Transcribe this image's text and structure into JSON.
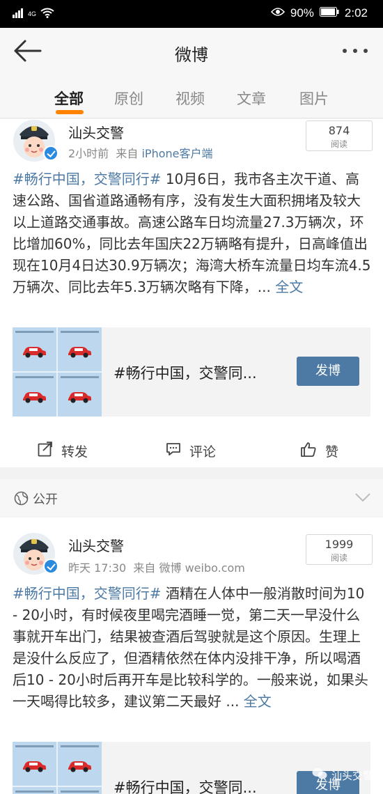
{
  "status_bar": {
    "network": "4G",
    "battery": "90%",
    "time": "2:02"
  },
  "app_bar": {
    "title": "微博"
  },
  "tabs": [
    {
      "label": "全部",
      "active": true
    },
    {
      "label": "原创",
      "active": false
    },
    {
      "label": "视频",
      "active": false
    },
    {
      "label": "文章",
      "active": false
    },
    {
      "label": "图片",
      "active": false
    }
  ],
  "posts": [
    {
      "username": "汕头交警",
      "time": "2小时前",
      "source_prefix": "来自",
      "source": "iPhone客户端",
      "reads_count": "874",
      "reads_label": "阅读",
      "hashtag": "#畅行中国，交警同行#",
      "body": " 10月6日，我市各主次干道、高速公路、国省道路通畅有序，没有发生大面积拥堵及较大以上道路交通事故。高速公路车日均流量27.3万辆次，环比增加60%，同比去年国庆22万辆略有提升，日高峰值出现在10月4日达30.9万辆次；海湾大桥车流量日均车流4.5万辆次、同比去年5.3万辆次略有下降，...",
      "more": " 全文",
      "share_text": "#畅行中国，交警同...",
      "share_button": "发博",
      "repost_label": "转发",
      "comment_label": "评论",
      "like_label": "赞"
    },
    {
      "username": "汕头交警",
      "time": "昨天 17:30",
      "source_prefix": "来自",
      "source": "微博 weibo.com",
      "reads_count": "1999",
      "reads_label": "阅读",
      "hashtag": "#畅行中国，交警同行#",
      "body": " 酒精在人体中一般消散时间为10 - 20小时，有时候夜里喝完酒睡一觉，第二天一早没什么事就开车出门，结果被查酒后驾驶就是这个原因。生理上是没什么反应了，但酒精依然在体内没排干净，所以喝酒后10 - 20小时后再开车是比较科学的。一般来说，如果头一天喝得比较多，建议第二天最好 ...",
      "more": " 全文",
      "share_text": "#畅行中国，交警同...",
      "share_button": "发博"
    }
  ],
  "visibility": {
    "label": "公开"
  },
  "watermark": "汕头交警",
  "colors": {
    "accent": "#ff8200",
    "link": "#4d7aa5",
    "verified": "#2a8ae0"
  }
}
